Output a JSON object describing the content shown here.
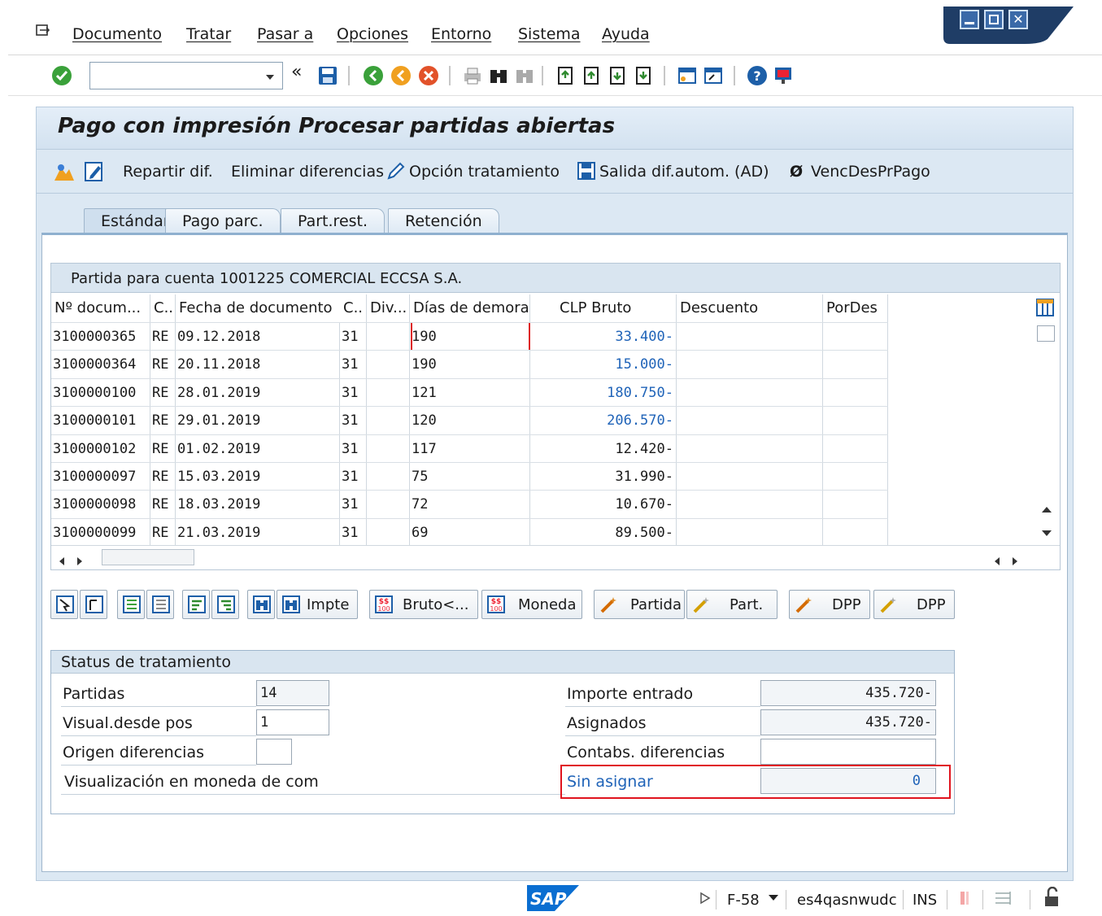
{
  "menubar": {
    "items": [
      "Documento",
      "Tratar",
      "Pasar a",
      "Opciones",
      "Entorno",
      "Sistema",
      "Ayuda"
    ]
  },
  "toolbar": {
    "command_field_value": "",
    "icons": [
      "enter-icon",
      "back-double-icon",
      "save-icon",
      "back-icon",
      "exit-icon",
      "cancel-icon",
      "print-icon",
      "find-icon",
      "find-next-icon",
      "first-page-icon",
      "prev-page-icon",
      "next-page-icon",
      "last-page-icon",
      "new-session-icon",
      "shortcut-icon",
      "help-icon",
      "customize-icon"
    ]
  },
  "screen": {
    "title": "Pago con impresión Procesar partidas abiertas",
    "app_toolbar": {
      "repartir": "Repartir dif.",
      "eliminar": "Eliminar diferencias",
      "opcion": "Opción tratamiento",
      "salida": "Salida dif.autom. (AD)",
      "venc": "VencDesPrPago"
    }
  },
  "tabs": [
    "Estándar",
    "Pago parc.",
    "Part.rest.",
    "Retención"
  ],
  "active_tab": "Estándar",
  "table": {
    "title": "Partida para cuenta 1001225 COMERCIAL ECCSA S.A.",
    "columns": [
      "Nº docum...",
      "C..",
      "Fecha de documento",
      "C..",
      "Div...",
      "Días de demora",
      "CLP Bruto",
      "Descuento",
      "PorDes"
    ],
    "rows": [
      {
        "doc": "3100000365",
        "cl": "RE",
        "fecha": "09.12.2018",
        "c": "31",
        "div": "",
        "dias": "190",
        "bruto": "33.400-",
        "blue": true
      },
      {
        "doc": "3100000364",
        "cl": "RE",
        "fecha": "20.11.2018",
        "c": "31",
        "div": "",
        "dias": "190",
        "bruto": "15.000-",
        "blue": true
      },
      {
        "doc": "3100000100",
        "cl": "RE",
        "fecha": "28.01.2019",
        "c": "31",
        "div": "",
        "dias": "121",
        "bruto": "180.750-",
        "blue": true
      },
      {
        "doc": "3100000101",
        "cl": "RE",
        "fecha": "29.01.2019",
        "c": "31",
        "div": "",
        "dias": "120",
        "bruto": "206.570-",
        "blue": true
      },
      {
        "doc": "3100000102",
        "cl": "RE",
        "fecha": "01.02.2019",
        "c": "31",
        "div": "",
        "dias": "117",
        "bruto": "12.420-",
        "blue": false
      },
      {
        "doc": "3100000097",
        "cl": "RE",
        "fecha": "15.03.2019",
        "c": "31",
        "div": "",
        "dias": "75",
        "bruto": "31.990-",
        "blue": false
      },
      {
        "doc": "3100000098",
        "cl": "RE",
        "fecha": "18.03.2019",
        "c": "31",
        "div": "",
        "dias": "72",
        "bruto": "10.670-",
        "blue": false
      },
      {
        "doc": "3100000099",
        "cl": "RE",
        "fecha": "21.03.2019",
        "c": "31",
        "div": "",
        "dias": "69",
        "bruto": "89.500-",
        "blue": false
      }
    ]
  },
  "buttons": {
    "impte": "Impte",
    "bruto": "Bruto<...",
    "moneda": "Moneda",
    "partida": "Partida",
    "part": "Part.",
    "dpp1": "DPP",
    "dpp2": "DPP"
  },
  "status": {
    "title": "Status de tratamiento",
    "partidas_label": "Partidas",
    "partidas_value": "14",
    "visual_label": "Visual.desde pos",
    "visual_value": "1",
    "origen_label": "Origen diferencias",
    "origen_value": "",
    "moneda_label": "Visualización en moneda de com",
    "importe_label": "Importe entrado",
    "importe_value": "435.720-",
    "asignados_label": "Asignados",
    "asignados_value": "435.720-",
    "contabs_label": "Contabs. diferencias",
    "contabs_value": "",
    "sin_label": "Sin asignar",
    "sin_value": "0"
  },
  "statusbar": {
    "logo": "SAP",
    "tcode": "F-58",
    "server": "es4qasnwudc",
    "mode": "INS"
  },
  "colors": {
    "frame_bg": "#dce8f3",
    "link_blue": "#1f63b8",
    "highlight_red": "#e0141e",
    "sap_blue": "#0a6ed1"
  }
}
